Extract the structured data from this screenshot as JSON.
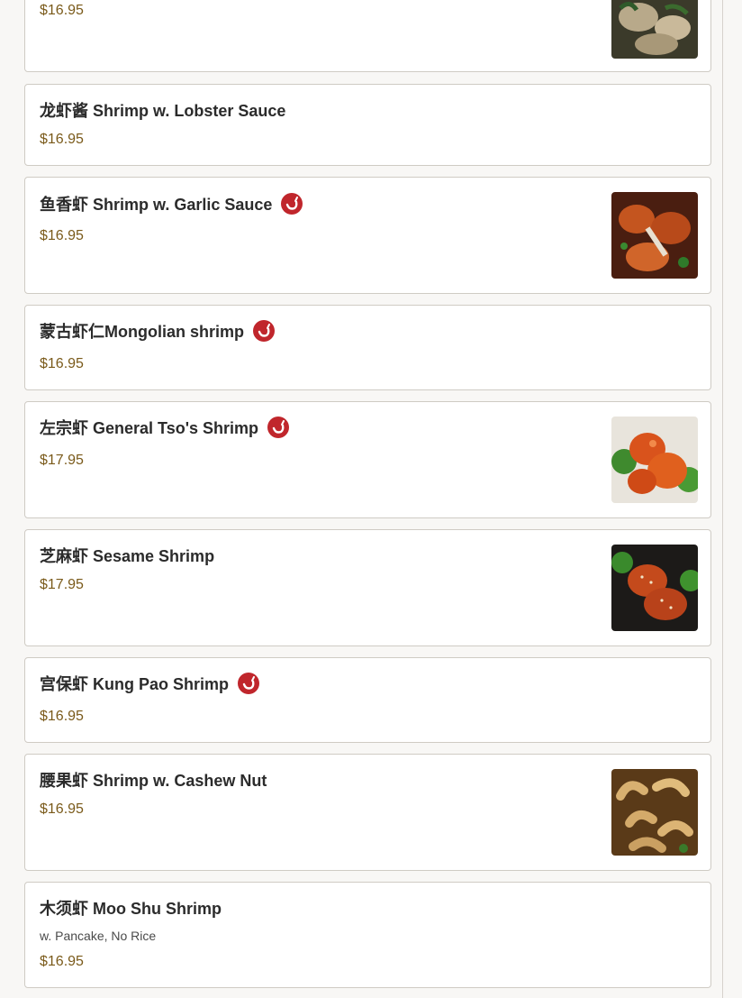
{
  "menu": {
    "items": [
      {
        "id": "top-partial",
        "title": "",
        "price": "$16.95",
        "spicy": false,
        "has_image": true,
        "image_desc": "shrimp-with-greens"
      },
      {
        "id": "lobster-sauce",
        "title": "龙虾酱 Shrimp w. Lobster Sauce",
        "price": "$16.95",
        "spicy": false,
        "has_image": false
      },
      {
        "id": "garlic-sauce",
        "title": "鱼香虾 Shrimp w. Garlic Sauce",
        "price": "$16.95",
        "spicy": true,
        "has_image": true,
        "image_desc": "garlic-sauce-shrimp"
      },
      {
        "id": "mongolian",
        "title": "蒙古虾仁Mongolian shrimp",
        "price": "$16.95",
        "spicy": true,
        "has_image": false
      },
      {
        "id": "general-tso",
        "title": "左宗虾 General Tso's Shrimp",
        "price": "$17.95",
        "spicy": true,
        "has_image": true,
        "image_desc": "general-tso-shrimp"
      },
      {
        "id": "sesame",
        "title": "芝麻虾 Sesame Shrimp",
        "price": "$17.95",
        "spicy": false,
        "has_image": true,
        "image_desc": "sesame-shrimp"
      },
      {
        "id": "kung-pao",
        "title": "宫保虾 Kung Pao Shrimp",
        "price": "$16.95",
        "spicy": true,
        "has_image": false
      },
      {
        "id": "cashew",
        "title": "腰果虾 Shrimp w. Cashew Nut",
        "price": "$16.95",
        "spicy": false,
        "has_image": true,
        "image_desc": "cashew-shrimp"
      },
      {
        "id": "moo-shu",
        "title": "木须虾 Moo Shu Shrimp",
        "description": "w. Pancake, No Rice",
        "price": "$16.95",
        "spicy": false,
        "has_image": false
      }
    ]
  },
  "colors": {
    "price": "#7a5a1a",
    "spicy_badge": "#c0262c",
    "card_border": "#cfcbc4",
    "page_background": "#f8f7f5"
  },
  "icons": {
    "spicy": "chili-pepper-icon"
  }
}
